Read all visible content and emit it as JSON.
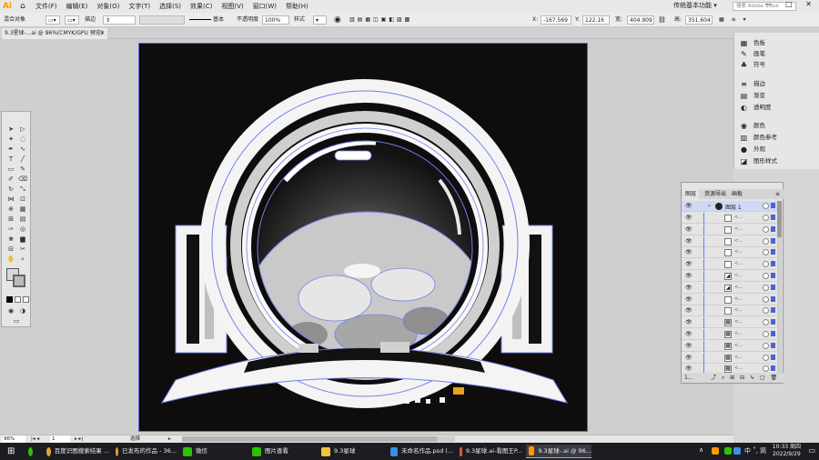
{
  "app": {
    "logo": "Ai",
    "home": "⌂",
    "workspace": "传统基本功能 ▾",
    "stock_search": "搜索 Adobe Stock",
    "win_controls": "—  □  ✕"
  },
  "menu": [
    "文件(F)",
    "编辑(E)",
    "对象(O)",
    "文字(T)",
    "选择(S)",
    "效果(C)",
    "视图(V)",
    "窗口(W)",
    "帮助(H)"
  ],
  "control": {
    "selection": "混合对象",
    "stroke_label": "描边",
    "brush": "基本",
    "opacity_label": "不透明度",
    "opacity_value": "100%",
    "style_label": "样式",
    "x_label": "X:",
    "x_value": "-167.569",
    "y_label": "Y:",
    "y_value": "122.16 mm",
    "w_label": "宽:",
    "w_value": "404.909",
    "h_label": "高:",
    "h_value": "351.604"
  },
  "document": {
    "tab": "9.3星球-...ai @ 96%(CMYK/GPU 预览)"
  },
  "dock": [
    {
      "icon": "swatches-icon",
      "glyph": "▦",
      "label": "色板"
    },
    {
      "icon": "brush-icon",
      "glyph": "✎",
      "label": "画笔"
    },
    {
      "icon": "symbol-icon",
      "glyph": "♣",
      "label": "符号"
    },
    {
      "icon": "stroke-icon",
      "glyph": "≡",
      "label": "描边"
    },
    {
      "icon": "gradient-icon",
      "glyph": "▤",
      "label": "渐变"
    },
    {
      "icon": "transparency-icon",
      "glyph": "◐",
      "label": "透明度"
    },
    {
      "icon": "color-icon",
      "glyph": "◉",
      "label": "颜色"
    },
    {
      "icon": "color-guide-icon",
      "glyph": "▥",
      "label": "颜色参考"
    },
    {
      "icon": "appearance-icon",
      "glyph": "●",
      "label": "外观"
    },
    {
      "icon": "graphic-styles-icon",
      "glyph": "◪",
      "label": "图形样式"
    }
  ],
  "layers": {
    "tabs": [
      "图层",
      "资源导出",
      "画板"
    ],
    "layer_name": "图层 1",
    "sublayer_label": "<...",
    "footer_count": "1...",
    "footer_icons": "⤴  ⌕  ⊞  ⊟  ↳  ▢  🗑"
  },
  "status": {
    "zoom": "96%",
    "page": "1",
    "tool": "选择"
  },
  "taskbar": {
    "start": "⊞",
    "items": [
      {
        "label": "百度识图搜索结果 ...",
        "color": "#e2a13a"
      },
      {
        "label": "已发布的作品 - 36...",
        "color": "#e2a13a"
      },
      {
        "label": "微信",
        "color": "#2dc100"
      },
      {
        "label": "图片查看",
        "color": "#2dc100"
      },
      {
        "label": "9.3星球",
        "color": "#f2c23a"
      },
      {
        "label": "未命名作品.psd (...",
        "color": "#3a8ee8"
      },
      {
        "label": "9.3星球.ai-看图王P...",
        "color": "#e8553a"
      },
      {
        "label": "9.3星球-.ai @ 96...",
        "color": "#ff9a00"
      }
    ],
    "ime": "中 ˚, 简",
    "time": "10:33 周四",
    "date": "2022/9/29"
  }
}
